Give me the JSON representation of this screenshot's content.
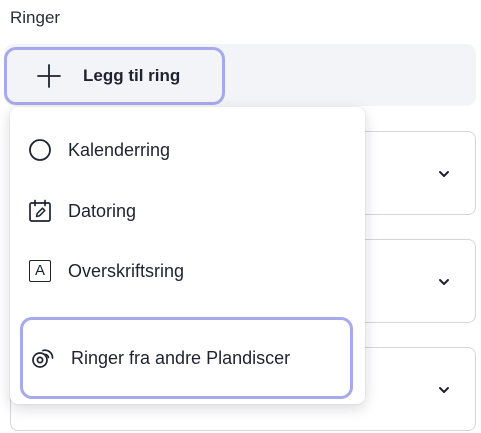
{
  "section": {
    "title": "Ringer"
  },
  "add_button": {
    "label": "Legg til ring",
    "icon": "plus-icon"
  },
  "menu": {
    "items": [
      {
        "label": "Kalenderring",
        "icon": "circle-icon"
      },
      {
        "label": "Datoring",
        "icon": "calendar-edit-icon"
      },
      {
        "label": "Overskriftsring",
        "icon": "letter-a-icon",
        "icon_text": "A"
      },
      {
        "label": "Ringer fra andre Plandiscer",
        "icon": "linked-rings-icon"
      }
    ]
  },
  "colors": {
    "highlight_border": "#a6a9ec",
    "bar_background": "#f3f4f7",
    "text": "#1f2230"
  }
}
